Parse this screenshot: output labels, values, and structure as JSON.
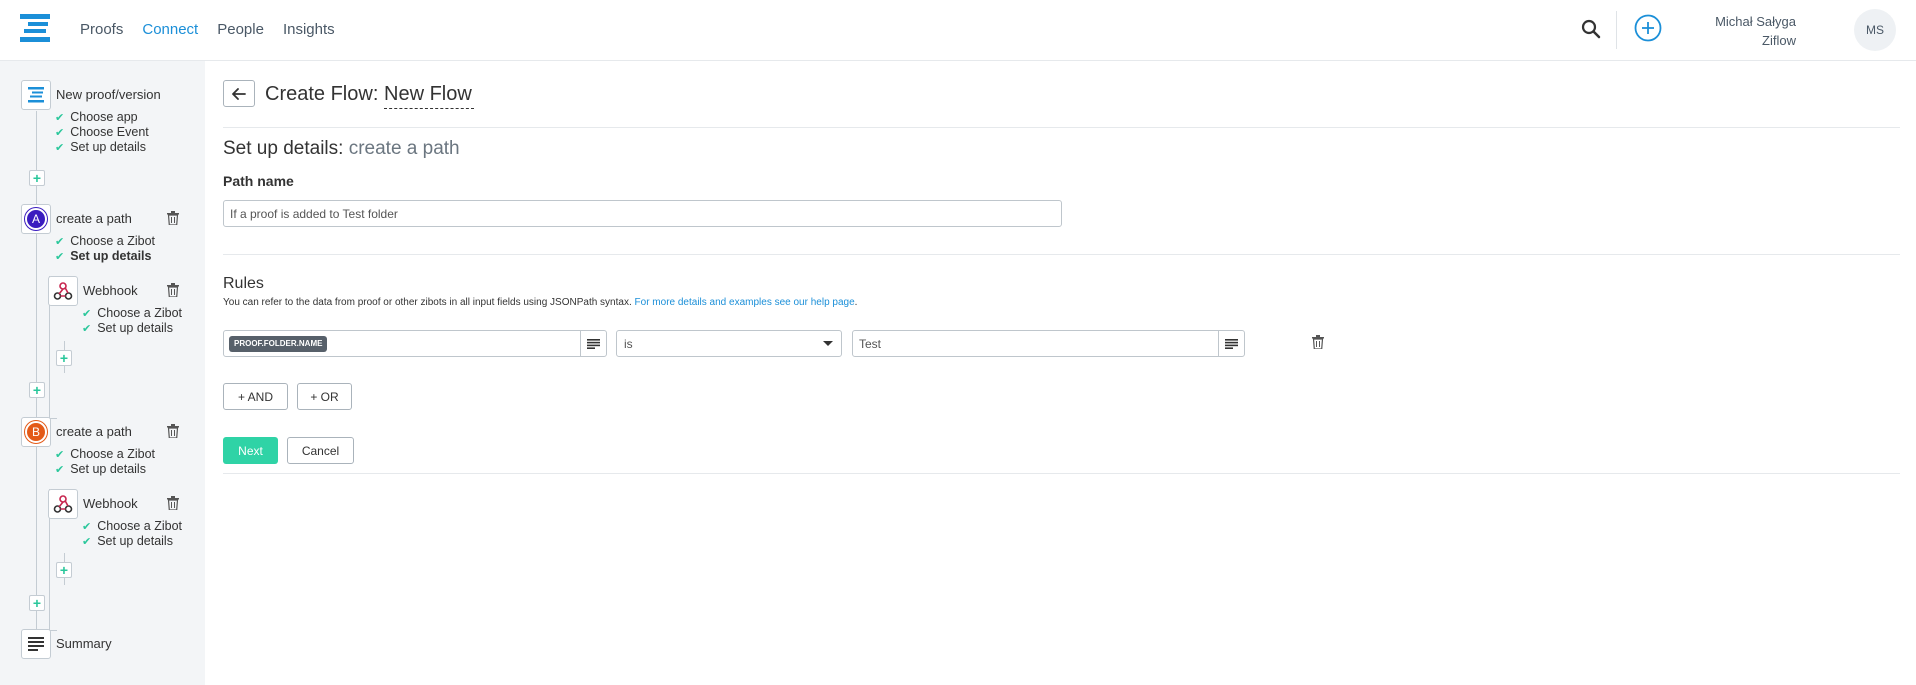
{
  "header": {
    "nav": [
      "Proofs",
      "Connect",
      "People",
      "Insights"
    ],
    "active_nav": "Connect",
    "user_name": "Michał Sałyga",
    "user_org": "Ziflow",
    "avatar_initials": "MS"
  },
  "sidebar": {
    "trigger": {
      "title": "New proof/version",
      "checks": [
        "Choose app",
        "Choose Event",
        "Set up details"
      ]
    },
    "path_a": {
      "badge": "A",
      "title": "create a path",
      "checks": [
        "Choose a Zibot",
        "Set up details"
      ],
      "webhook": {
        "title": "Webhook",
        "checks": [
          "Choose a Zibot",
          "Set up details"
        ]
      }
    },
    "path_b": {
      "badge": "B",
      "title": "create a path",
      "checks": [
        "Choose a Zibot",
        "Set up details"
      ],
      "webhook": {
        "title": "Webhook",
        "checks": [
          "Choose a Zibot",
          "Set up details"
        ]
      }
    },
    "summary": "Summary"
  },
  "main": {
    "title_prefix": "Create Flow:",
    "flow_name": "New Flow",
    "section_title": "Set up details:",
    "section_sub": "create a path",
    "path_name_label": "Path name",
    "path_name_value": "If a proof is added to Test folder",
    "rules_title": "Rules",
    "rules_help": "You can refer to the data from proof or other zibots in all input fields using JSONPath syntax.",
    "rules_help_link": "For more details and examples see our help page",
    "rules_help_end": ".",
    "rule": {
      "field_token": "PROOF.FOLDER.NAME",
      "operator": "is",
      "value": "Test"
    },
    "and_label": "+ AND",
    "or_label": "+ OR",
    "next_label": "Next",
    "cancel_label": "Cancel"
  },
  "colors": {
    "accent": "#1b8fd8",
    "check": "#2ac79b",
    "next": "#2fd3a6",
    "badge_a": "#3a1cbf",
    "badge_b": "#e35a18"
  }
}
